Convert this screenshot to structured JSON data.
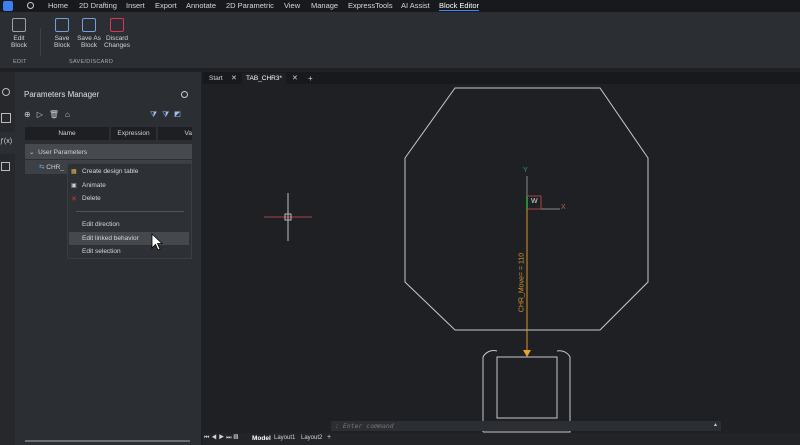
{
  "menu": {
    "items": [
      "Home",
      "2D Drafting",
      "Insert",
      "Export",
      "Annotate",
      "2D Parametric",
      "View",
      "Manage",
      "ExpressTools",
      "AI Assist",
      "Block Editor"
    ],
    "active": "Block Editor"
  },
  "ribbon": {
    "edit_block": "Edit Block",
    "save_block": "Save Block",
    "save_as_block": "Save As Block",
    "discard_changes": "Discard Changes",
    "group_edit": "EDIT",
    "group_save": "SAVE/DISCARD"
  },
  "tabs": {
    "start": "Start",
    "drawing": "TAB_CHR3*",
    "add": "+"
  },
  "panel": {
    "title": "Parameters Manager",
    "columns": [
      "Name",
      "Expression",
      "Va"
    ],
    "group": "User Parameters",
    "param": "CHR_"
  },
  "context_menu": [
    "Create design table",
    "Animate",
    "Delete",
    "Edit direction",
    "Edit linked behavior",
    "Edit selection"
  ],
  "canvas": {
    "dimension_label": "CHR_Move= = 110",
    "axis_y": "Y",
    "axis_x": "X",
    "ucs_w": "W"
  },
  "command": {
    "placeholder": ": Enter command"
  },
  "layout_tabs": [
    "Model",
    "Layout1",
    "Layout2",
    "+"
  ],
  "colors": {
    "accent": "#3d8af7",
    "dimension": "#d9952a"
  }
}
